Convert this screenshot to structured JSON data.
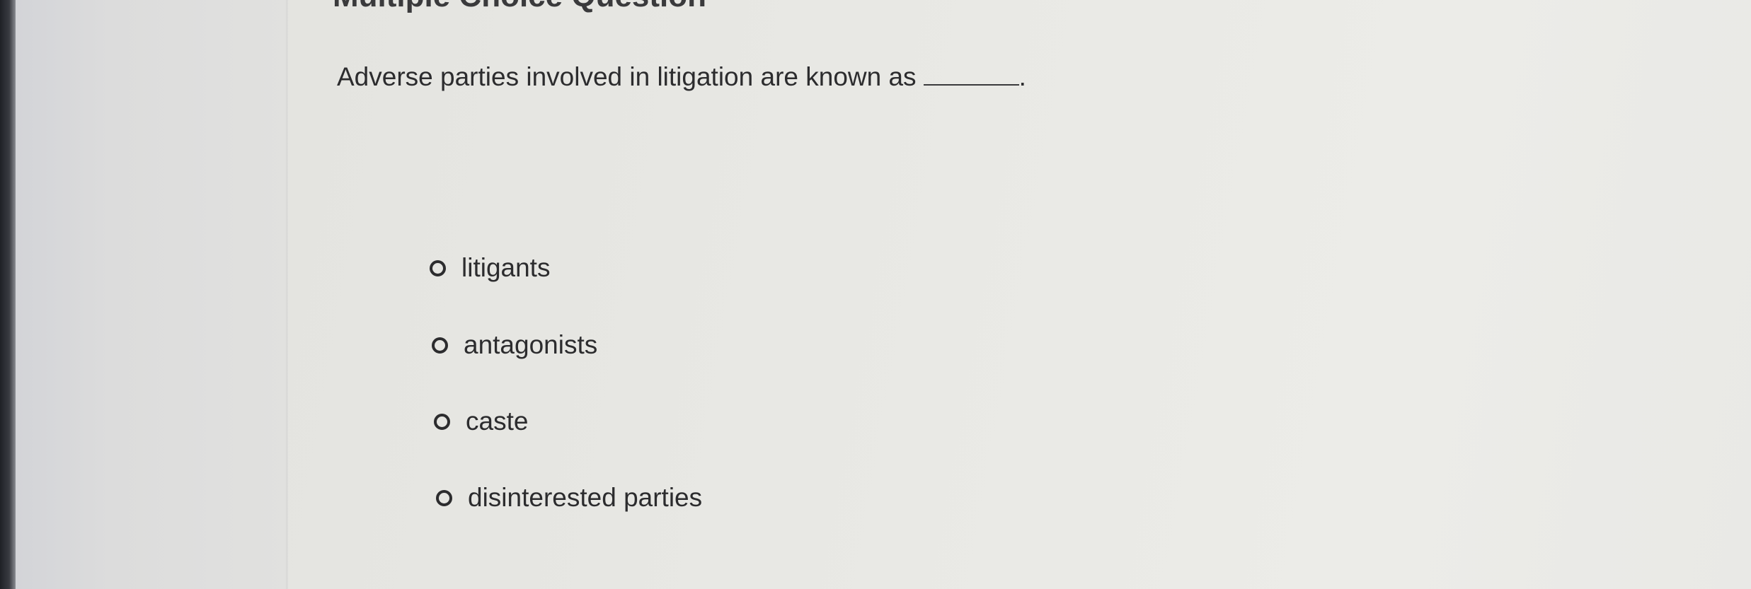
{
  "header": {
    "title": "Multiple Choice Question"
  },
  "question": {
    "text": "Adverse parties involved in litigation are known as",
    "blank_suffix": "."
  },
  "options": [
    {
      "label": "litigants"
    },
    {
      "label": "antagonists"
    },
    {
      "label": "caste"
    },
    {
      "label": "disinterested parties"
    }
  ]
}
